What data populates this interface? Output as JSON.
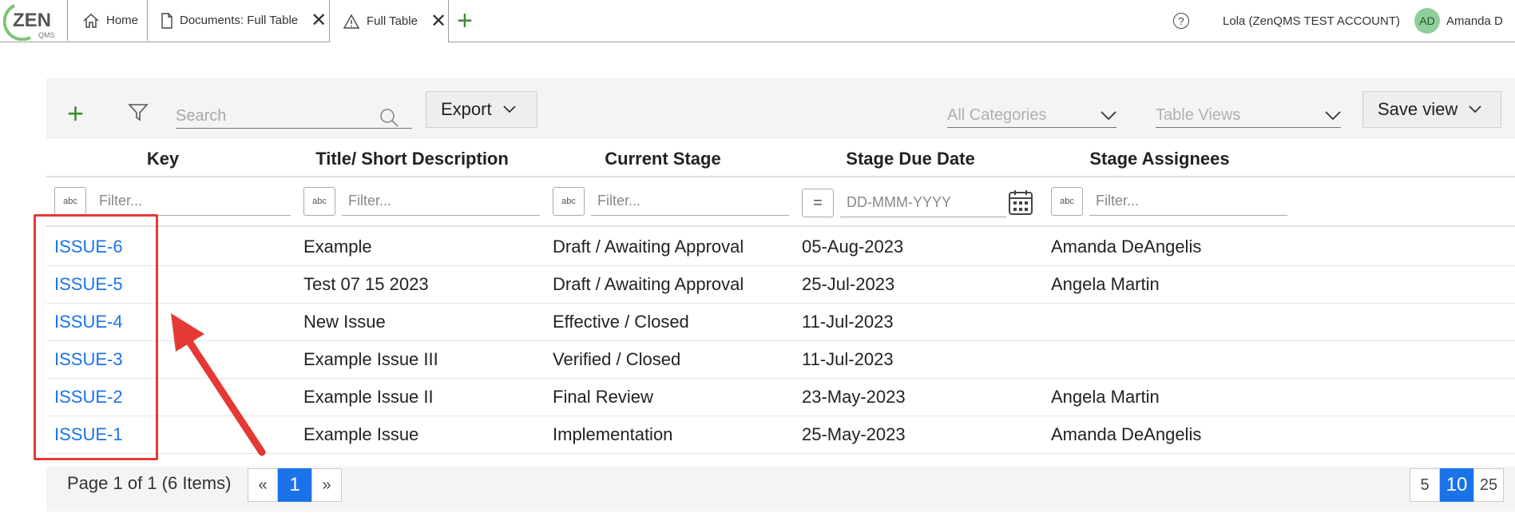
{
  "header": {
    "logo_text": "ZEN",
    "logo_sub": "QMS",
    "tabs": [
      {
        "label": "Home",
        "icon": "home-icon"
      },
      {
        "label": "Documents: Full Table",
        "icon": "document-icon"
      },
      {
        "label": "Full Table",
        "icon": "warning-icon"
      }
    ],
    "help": "?",
    "account": "Lola (ZenQMS TEST ACCOUNT)",
    "avatar_initials": "AD",
    "user_name": "Amanda D"
  },
  "toolbar": {
    "search_placeholder": "Search",
    "export_label": "Export",
    "categories_placeholder": "All Categories",
    "views_placeholder": "Table Views",
    "save_view_label": "Save view"
  },
  "table": {
    "columns": [
      "Key",
      "Title/ Short Description",
      "Current Stage",
      "Stage Due Date",
      "Stage Assignees"
    ],
    "filter_placeholder": "Filter...",
    "date_placeholder": "DD-MMM-YYYY",
    "abc_label": "abc",
    "eq_label": "=",
    "rows": [
      {
        "key": "ISSUE-6",
        "title": "Example",
        "stage": "Draft / Awaiting Approval",
        "due": "05-Aug-2023",
        "assignees": "Amanda DeAngelis"
      },
      {
        "key": "ISSUE-5",
        "title": "Test 07 15 2023",
        "stage": "Draft / Awaiting Approval",
        "due": "25-Jul-2023",
        "assignees": "Angela Martin"
      },
      {
        "key": "ISSUE-4",
        "title": "New Issue",
        "stage": "Effective / Closed",
        "due": "11-Jul-2023",
        "assignees": ""
      },
      {
        "key": "ISSUE-3",
        "title": "Example Issue III",
        "stage": "Verified / Closed",
        "due": "11-Jul-2023",
        "assignees": ""
      },
      {
        "key": "ISSUE-2",
        "title": "Example Issue II",
        "stage": "Final Review",
        "due": "23-May-2023",
        "assignees": "Angela Martin"
      },
      {
        "key": "ISSUE-1",
        "title": "Example Issue",
        "stage": "Implementation",
        "due": "25-May-2023",
        "assignees": "Amanda DeAngelis"
      }
    ]
  },
  "footer": {
    "page_info": "Page 1 of 1 (6 Items)",
    "prev": "«",
    "current_page": "1",
    "next": "»",
    "page_sizes": [
      "5",
      "10",
      "25"
    ],
    "active_size": "10"
  },
  "colors": {
    "accent": "#1a73e8",
    "green": "#3e8e2e",
    "annotation": "#e53935"
  }
}
